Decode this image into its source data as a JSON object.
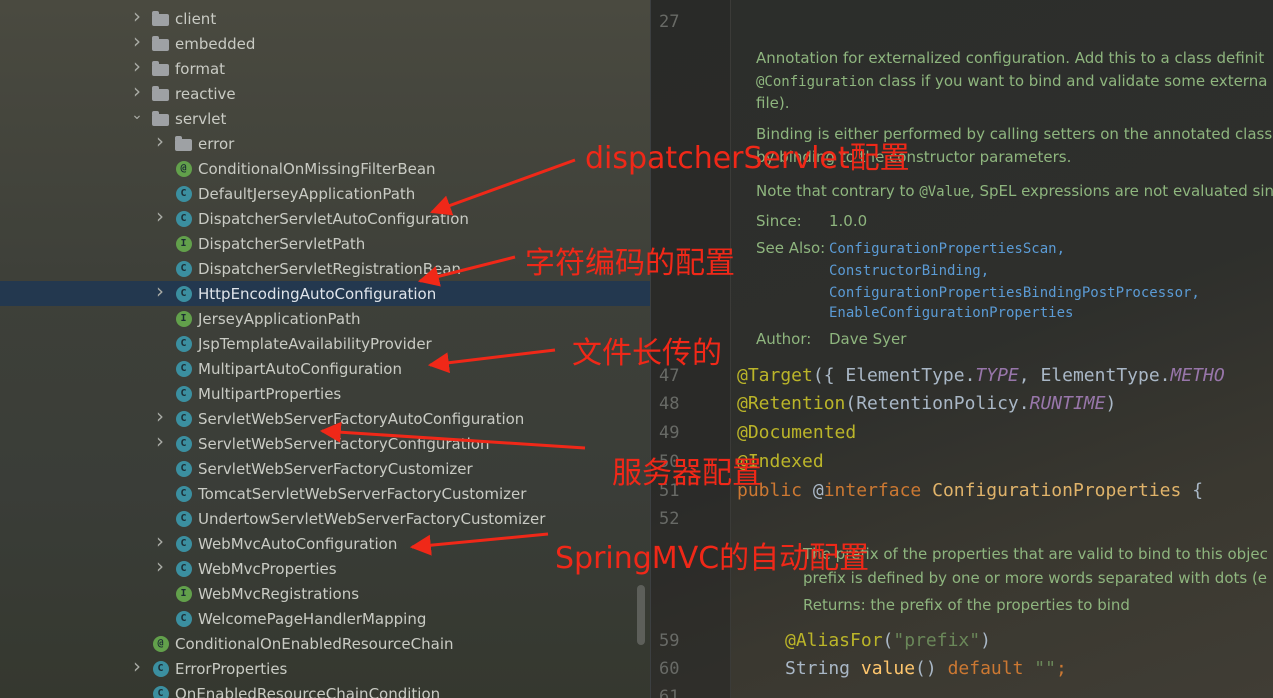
{
  "tree": {
    "items": [
      {
        "label": "client",
        "icon": "folder",
        "arrow": "right",
        "indent": 0
      },
      {
        "label": "embedded",
        "icon": "folder",
        "arrow": "right",
        "indent": 0
      },
      {
        "label": "format",
        "icon": "folder",
        "arrow": "right",
        "indent": 0
      },
      {
        "label": "reactive",
        "icon": "folder",
        "arrow": "right",
        "indent": 0
      },
      {
        "label": "servlet",
        "icon": "folder",
        "arrow": "down",
        "indent": 0
      },
      {
        "label": "error",
        "icon": "folder",
        "arrow": "right",
        "indent": 1
      },
      {
        "label": "ConditionalOnMissingFilterBean",
        "icon": "annotation",
        "arrow": "",
        "indent": 1
      },
      {
        "label": "DefaultJerseyApplicationPath",
        "icon": "class",
        "arrow": "",
        "indent": 1
      },
      {
        "label": "DispatcherServletAutoConfiguration",
        "icon": "class",
        "arrow": "right",
        "indent": 1
      },
      {
        "label": "DispatcherServletPath",
        "icon": "interface",
        "arrow": "",
        "indent": 1
      },
      {
        "label": "DispatcherServletRegistrationBean",
        "icon": "class",
        "arrow": "",
        "indent": 1
      },
      {
        "label": "HttpEncodingAutoConfiguration",
        "icon": "class",
        "arrow": "right",
        "indent": 1,
        "selected": true
      },
      {
        "label": "JerseyApplicationPath",
        "icon": "interface",
        "arrow": "",
        "indent": 1
      },
      {
        "label": "JspTemplateAvailabilityProvider",
        "icon": "class",
        "arrow": "",
        "indent": 1
      },
      {
        "label": "MultipartAutoConfiguration",
        "icon": "class",
        "arrow": "",
        "indent": 1
      },
      {
        "label": "MultipartProperties",
        "icon": "class",
        "arrow": "",
        "indent": 1
      },
      {
        "label": "ServletWebServerFactoryAutoConfiguration",
        "icon": "class",
        "arrow": "right",
        "indent": 1
      },
      {
        "label": "ServletWebServerFactoryConfiguration",
        "icon": "class",
        "arrow": "right",
        "indent": 1
      },
      {
        "label": "ServletWebServerFactoryCustomizer",
        "icon": "class",
        "arrow": "",
        "indent": 1
      },
      {
        "label": "TomcatServletWebServerFactoryCustomizer",
        "icon": "class",
        "arrow": "",
        "indent": 1
      },
      {
        "label": "UndertowServletWebServerFactoryCustomizer",
        "icon": "class",
        "arrow": "",
        "indent": 1
      },
      {
        "label": "WebMvcAutoConfiguration",
        "icon": "class",
        "arrow": "right",
        "indent": 1
      },
      {
        "label": "WebMvcProperties",
        "icon": "class",
        "arrow": "right",
        "indent": 1
      },
      {
        "label": "WebMvcRegistrations",
        "icon": "interface",
        "arrow": "",
        "indent": 1
      },
      {
        "label": "WelcomePageHandlerMapping",
        "icon": "class",
        "arrow": "",
        "indent": 1
      },
      {
        "label": "ConditionalOnEnabledResourceChain",
        "icon": "annotation",
        "arrow": "",
        "indent": 0
      },
      {
        "label": "ErrorProperties",
        "icon": "class",
        "arrow": "right",
        "indent": 0
      },
      {
        "label": "OnEnabledResourceChainCondition",
        "icon": "class",
        "arrow": "",
        "indent": 0
      }
    ]
  },
  "editor": {
    "line_numbers": [
      "27",
      "47",
      "48",
      "49",
      "50",
      "51",
      "52",
      "59",
      "60",
      "61"
    ],
    "doc": {
      "p1a": "Annotation for externalized configuration. Add this to a class definit",
      "p1b_code": "@Configuration",
      "p1b_text": " class if you want to bind and validate some externa",
      "p1c": "file).",
      "p2a": "Binding is either performed by calling setters on the annotated class",
      "p2b": "by binding to the constructor parameters.",
      "p3_text": "Note that contrary to ",
      "p3_code": "@Value",
      "p3_rest": ", SpEL expressions are not evaluated sin",
      "since_label": "Since:",
      "since_value": "1.0.0",
      "see_label": "See Also:",
      "see_links": [
        "ConfigurationPropertiesScan,",
        "ConstructorBinding,",
        "ConfigurationPropertiesBindingPostProcessor,",
        "EnableConfigurationProperties"
      ],
      "author_label": "Author:",
      "author_value": "Dave Syer"
    },
    "code": {
      "l47_a": "@Target",
      "l47_b": "({ ElementType.",
      "l47_c": "TYPE",
      "l47_d": ", ElementType.",
      "l47_e": "METHO",
      "l48_a": "@Retention",
      "l48_b": "(RetentionPolicy.",
      "l48_c": "RUNTIME",
      "l48_d": ")",
      "l49": "@Documented",
      "l50": "@Indexed",
      "l51_kw": "public",
      "l51_at": " @",
      "l51_kw2": "interface",
      "l51_cls": " ConfigurationProperties",
      "l51_brace": " {",
      "doc2a": "The prefix of the properties that are valid to bind to this objec",
      "doc2b": "prefix is defined by one or more words separated with dots (e",
      "doc2c": "Returns: the prefix of the properties to bind",
      "l59_a": "@AliasFor",
      "l59_b": "(",
      "l59_c": "\"prefix\"",
      "l59_d": ")",
      "l60_a": "String ",
      "l60_b": "value",
      "l60_c": "() ",
      "l60_d": "default",
      "l60_e": " \"\"",
      "l60_f": ";"
    }
  },
  "annotations": [
    {
      "text": "dispatcherServlet配置"
    },
    {
      "text": "字符编码的配置"
    },
    {
      "text": "文件长传的"
    },
    {
      "text": "服务器配置"
    },
    {
      "text": "SpringMVC的自动配置"
    }
  ],
  "colors": {
    "annotation_red": "#f02818",
    "selection": "#23384f"
  }
}
